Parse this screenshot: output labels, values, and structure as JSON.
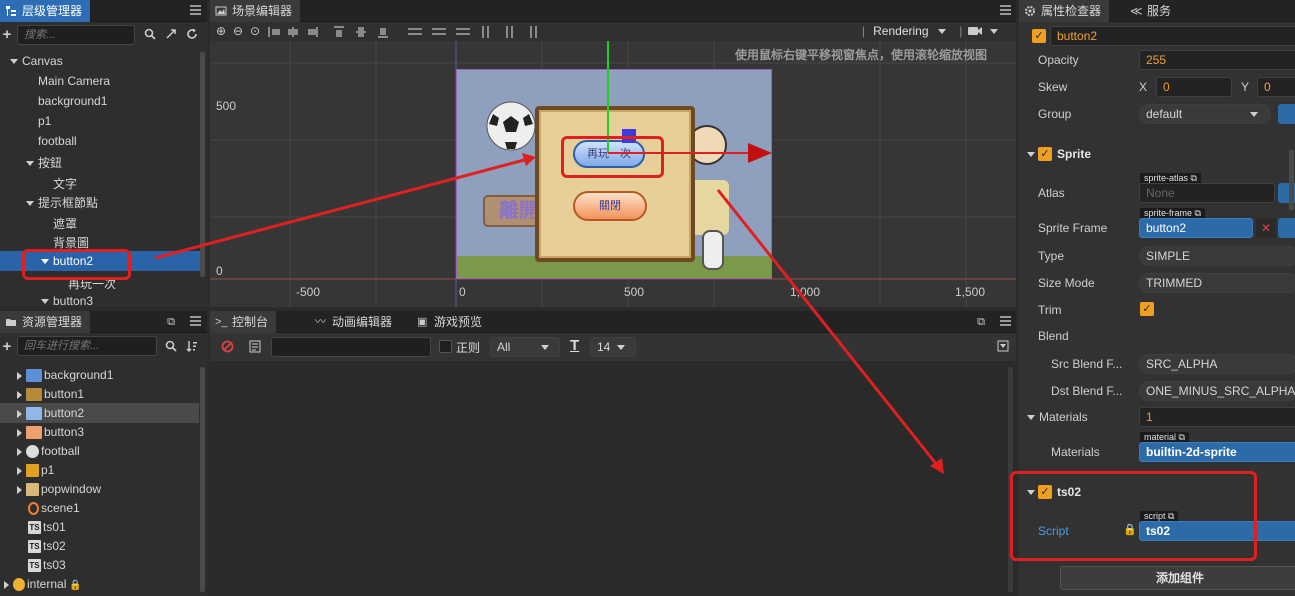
{
  "hierarchy": {
    "tab_label": "层级管理器",
    "search_placeholder": "搜索...",
    "items": [
      {
        "label": "Canvas"
      },
      {
        "label": "Main Camera"
      },
      {
        "label": "background1"
      },
      {
        "label": "p1"
      },
      {
        "label": "football"
      },
      {
        "label": "按鈕"
      },
      {
        "label": "文字"
      },
      {
        "label": "提示框節點"
      },
      {
        "label": "遮罩"
      },
      {
        "label": "背景圖"
      },
      {
        "label": "button2"
      },
      {
        "label": "再玩一次"
      },
      {
        "label": "button3"
      }
    ]
  },
  "scene": {
    "tab_label": "场景编辑器",
    "render_mode": "Rendering",
    "hint": "使用鼠标右键平移视窗焦点，使用滚轮缩放视图",
    "y_labels": [
      "500",
      "0"
    ],
    "x_labels": [
      "-500",
      "0",
      "500",
      "1,000",
      "1,500"
    ],
    "popup_button_top": "再玩一次",
    "popup_button_bottom": "關閉",
    "leave_button": "離開"
  },
  "assets": {
    "tab_label": "资源管理器",
    "search_placeholder": "回车进行搜索...",
    "items": [
      {
        "label": "background1",
        "color": "#5b8fd6"
      },
      {
        "label": "button1",
        "color": "#b58a3a"
      },
      {
        "label": "button2",
        "color": "#8fb8e8"
      },
      {
        "label": "button3",
        "color": "#f0a070"
      },
      {
        "label": "football",
        "color": "#dddddd"
      },
      {
        "label": "p1",
        "color": "#e0a020"
      },
      {
        "label": "popwindow",
        "color": "#d9b87a"
      },
      {
        "label": "scene1",
        "color": "#f08030"
      },
      {
        "label": "ts01",
        "color": "#cccccc"
      },
      {
        "label": "ts02",
        "color": "#cccccc"
      },
      {
        "label": "ts03",
        "color": "#cccccc"
      },
      {
        "label": "internal",
        "color": "#f0b030"
      }
    ]
  },
  "console": {
    "tabs": [
      "控制台",
      "动画编辑器",
      "游戏预览"
    ],
    "regex_label": "正则",
    "level": "All",
    "font_size": "14"
  },
  "inspector": {
    "tabs": [
      "属性检查器",
      "服务"
    ],
    "node_name": "button2",
    "opacity_label": "Opacity",
    "opacity": "255",
    "skew_label": "Skew",
    "skew_x_label": "X",
    "skew_x": "0",
    "skew_y_label": "Y",
    "skew_y": "0",
    "group_label": "Group",
    "group": "default",
    "sprite_title": "Sprite",
    "atlas_label": "Atlas",
    "atlas_tag": "sprite-atlas",
    "atlas_value": "None",
    "frame_label": "Sprite Frame",
    "frame_tag": "sprite-frame",
    "frame_value": "button2",
    "type_label": "Type",
    "type_value": "SIMPLE",
    "size_mode_label": "Size Mode",
    "size_mode_value": "TRIMMED",
    "trim_label": "Trim",
    "blend_label": "Blend",
    "src_blend_label": "Src Blend F...",
    "src_blend_value": "SRC_ALPHA",
    "dst_blend_label": "Dst Blend F...",
    "dst_blend_value": "ONE_MINUS_SRC_ALPHA",
    "materials_label": "Materials",
    "materials_count": "1",
    "materials_sub_label": "Materials",
    "material_tag": "material",
    "material_value": "builtin-2d-sprite",
    "script_comp_title": "ts02",
    "script_label": "Script",
    "script_tag": "script",
    "script_value": "ts02",
    "add_component": "添加组件"
  }
}
